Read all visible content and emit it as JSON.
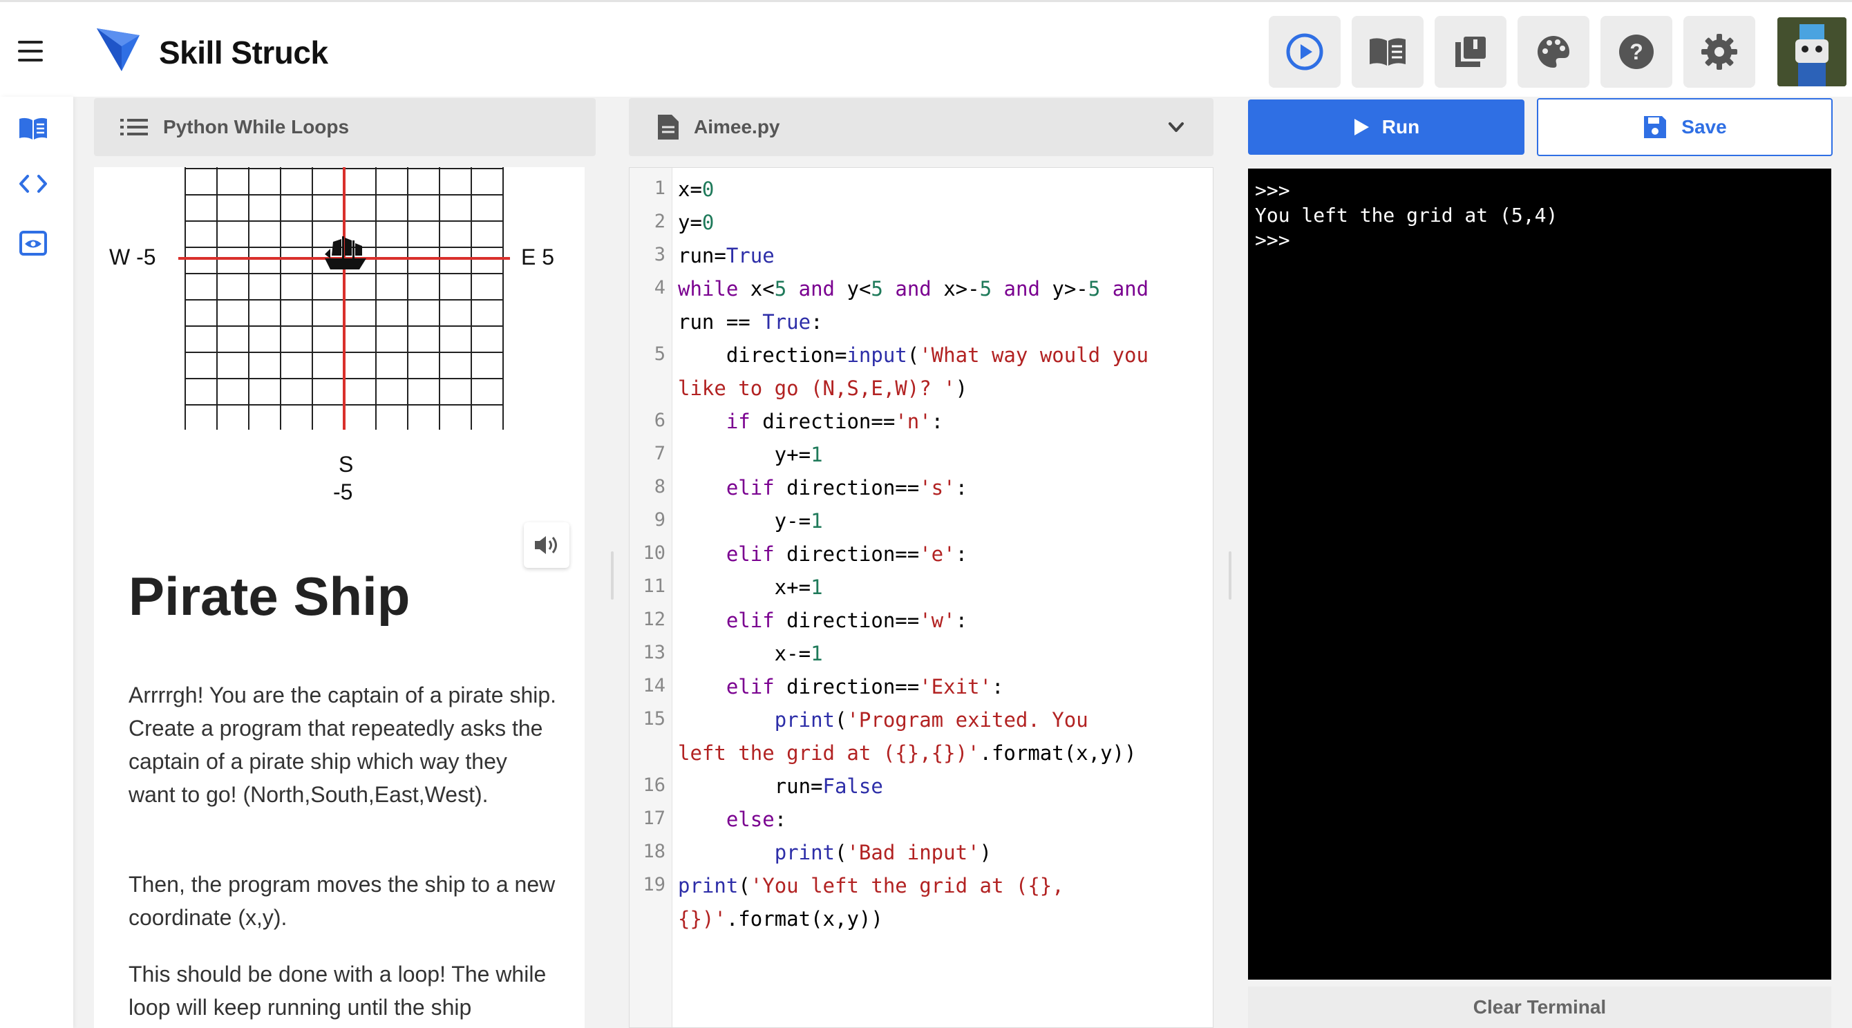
{
  "app": {
    "brand": "Skill Struck"
  },
  "header": {
    "icons": [
      "play-circle-icon",
      "book-open-icon",
      "library-icon",
      "palette-icon",
      "help-icon",
      "settings-icon"
    ]
  },
  "lesson": {
    "title_bar": "Python While Loops",
    "compass": {
      "west": "W -5",
      "east": "E 5",
      "south_letter": "S",
      "south_value": "-5"
    },
    "heading": "Pirate Ship",
    "paragraphs": [
      "Arrrrgh! You are the captain of a pirate ship. Create a program that repeatedly asks the captain of a pirate ship which way they want to go! (North,South,East,West).",
      "Then, the program moves the ship to a new coordinate (x,y).",
      "This should be done with a loop! The while loop will keep running until the ship"
    ]
  },
  "editor": {
    "file_name": "Aimee.py",
    "line_numbers": [
      "1",
      "2",
      "3",
      "4",
      "5",
      "6",
      "7",
      "8",
      "9",
      "10",
      "11",
      "12",
      "13",
      "14",
      "15",
      "16",
      "17",
      "18",
      "19"
    ]
  },
  "actions": {
    "run_label": "Run",
    "save_label": "Save",
    "clear_label": "Clear Terminal"
  },
  "terminal": {
    "output": ">>>\nYou left the grid at (5,4)\n>>>"
  },
  "colors": {
    "accent": "#2f6fe4",
    "terminal_bg": "#000000",
    "axis_red": "#d9302c"
  }
}
